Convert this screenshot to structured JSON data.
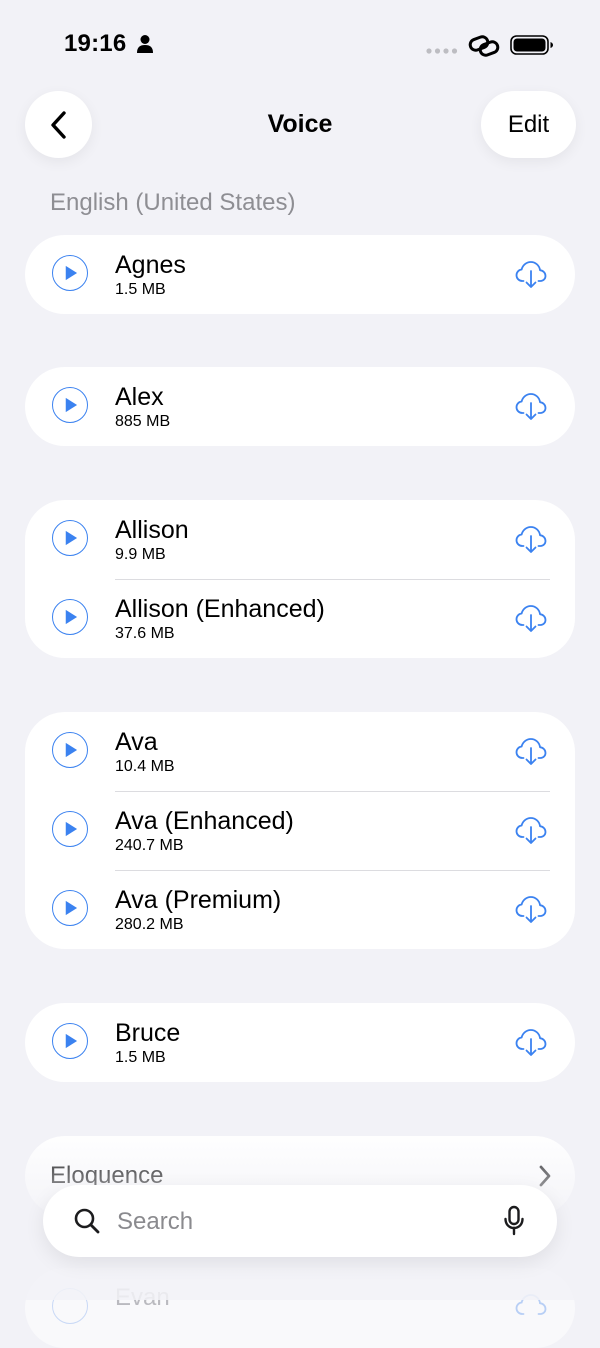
{
  "status_bar": {
    "time": "19:16"
  },
  "nav": {
    "title": "Voice",
    "edit_label": "Edit"
  },
  "section": {
    "header": "English (United States)"
  },
  "groups": [
    {
      "items": [
        {
          "name": "Agnes",
          "size": "1.5 MB"
        }
      ]
    },
    {
      "items": [
        {
          "name": "Alex",
          "size": "885 MB"
        }
      ]
    },
    {
      "items": [
        {
          "name": "Allison",
          "size": "9.9 MB"
        },
        {
          "name": "Allison (Enhanced)",
          "size": "37.6 MB"
        }
      ]
    },
    {
      "items": [
        {
          "name": "Ava",
          "size": "10.4 MB"
        },
        {
          "name": "Ava (Enhanced)",
          "size": "240.7 MB"
        },
        {
          "name": "Ava (Premium)",
          "size": "280.2 MB"
        }
      ]
    },
    {
      "items": [
        {
          "name": "Bruce",
          "size": "1.5 MB"
        }
      ]
    }
  ],
  "eloquence": {
    "label": "Eloquence"
  },
  "peek": {
    "label": "Evan"
  },
  "search": {
    "placeholder": "Search"
  },
  "icons": {
    "play": "play-icon",
    "download": "cloud-download-icon",
    "back": "chevron-left-icon",
    "forward": "chevron-right-icon",
    "search": "magnifier-icon",
    "mic": "microphone-icon"
  },
  "colors": {
    "accent": "#3b82f0",
    "background": "#f2f2f7",
    "secondary_text": "#8e8e93"
  }
}
